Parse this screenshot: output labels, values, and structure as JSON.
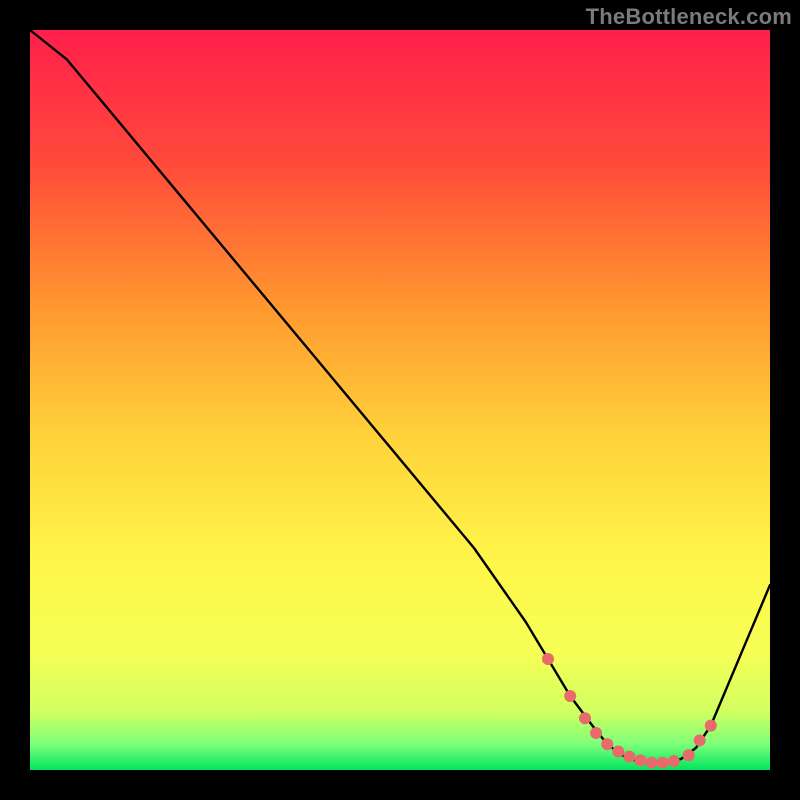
{
  "watermark": "TheBottleneck.com",
  "plot": {
    "margin_left": 30,
    "margin_right": 30,
    "margin_top": 30,
    "margin_bottom": 30,
    "inner_w": 740,
    "inner_h": 740
  },
  "gradient": {
    "stops": [
      {
        "offset": 0.0,
        "color": "#ff1f4b"
      },
      {
        "offset": 0.18,
        "color": "#ff4a3a"
      },
      {
        "offset": 0.38,
        "color": "#ff9a2f"
      },
      {
        "offset": 0.55,
        "color": "#ffd23a"
      },
      {
        "offset": 0.72,
        "color": "#fff64a"
      },
      {
        "offset": 0.84,
        "color": "#f6ff55"
      },
      {
        "offset": 0.92,
        "color": "#d2ff60"
      },
      {
        "offset": 0.965,
        "color": "#7dff7a"
      },
      {
        "offset": 1.0,
        "color": "#00e65c"
      }
    ]
  },
  "chart_data": {
    "type": "line",
    "title": "",
    "xlabel": "",
    "ylabel": "",
    "xlim": [
      0,
      100
    ],
    "ylim": [
      0,
      100
    ],
    "series": [
      {
        "name": "bottleneck-curve",
        "x": [
          0,
          5,
          10,
          20,
          30,
          40,
          50,
          60,
          67,
          70,
          73,
          76,
          78,
          80,
          82,
          84,
          86,
          88,
          90,
          92,
          100
        ],
        "y": [
          100,
          96,
          90,
          78,
          66,
          54,
          42,
          30,
          20,
          15,
          10,
          6,
          3.5,
          2,
          1.2,
          1,
          1,
          1.5,
          3,
          6,
          25
        ]
      }
    ],
    "markers": {
      "name": "highlight-dots",
      "color": "#e86a6a",
      "radius": 6,
      "x": [
        70,
        73,
        75,
        76.5,
        78,
        79.5,
        81,
        82.5,
        84,
        85.5,
        87,
        89,
        90.5,
        92
      ],
      "y": [
        15,
        10,
        7,
        5,
        3.5,
        2.5,
        1.8,
        1.3,
        1,
        1,
        1.2,
        2,
        4,
        6
      ]
    }
  }
}
